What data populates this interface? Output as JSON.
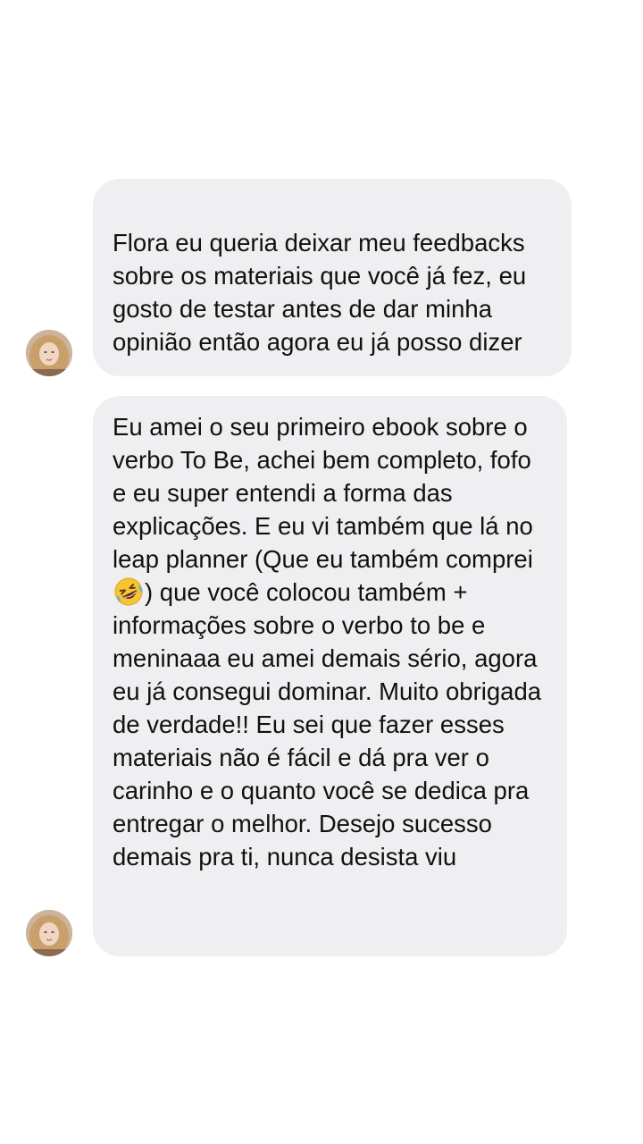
{
  "messages": [
    {
      "sender_avatar_icon": "user-avatar-photo",
      "text": "Flora eu queria deixar meu feedbacks sobre os materiais que você já fez, eu gosto de testar antes de dar minha opinião então agora eu já posso dizer"
    },
    {
      "sender_avatar_icon": "user-avatar-photo",
      "text_before_emoji": "Eu amei o seu primeiro ebook sobre o verbo To Be, achei bem completo, fofo e eu super entendi a forma das explicações. E eu vi também que lá no leap planner (Que eu também comprei ",
      "emoji_icon": "rolling-on-floor-laughing-emoji",
      "text_after_emoji": ") que você colocou também + informações sobre o verbo to be e meninaaa eu amei demais sério, agora eu já consegui dominar. Muito obrigada de verdade!! Eu sei que fazer esses materiais não é fácil e dá pra ver o carinho e o quanto você se dedica pra entregar o melhor. Desejo sucesso demais pra ti, nunca desista viu"
    }
  ],
  "colors": {
    "background": "#ffffff",
    "bubble": "#efeff1",
    "text": "#111111"
  }
}
